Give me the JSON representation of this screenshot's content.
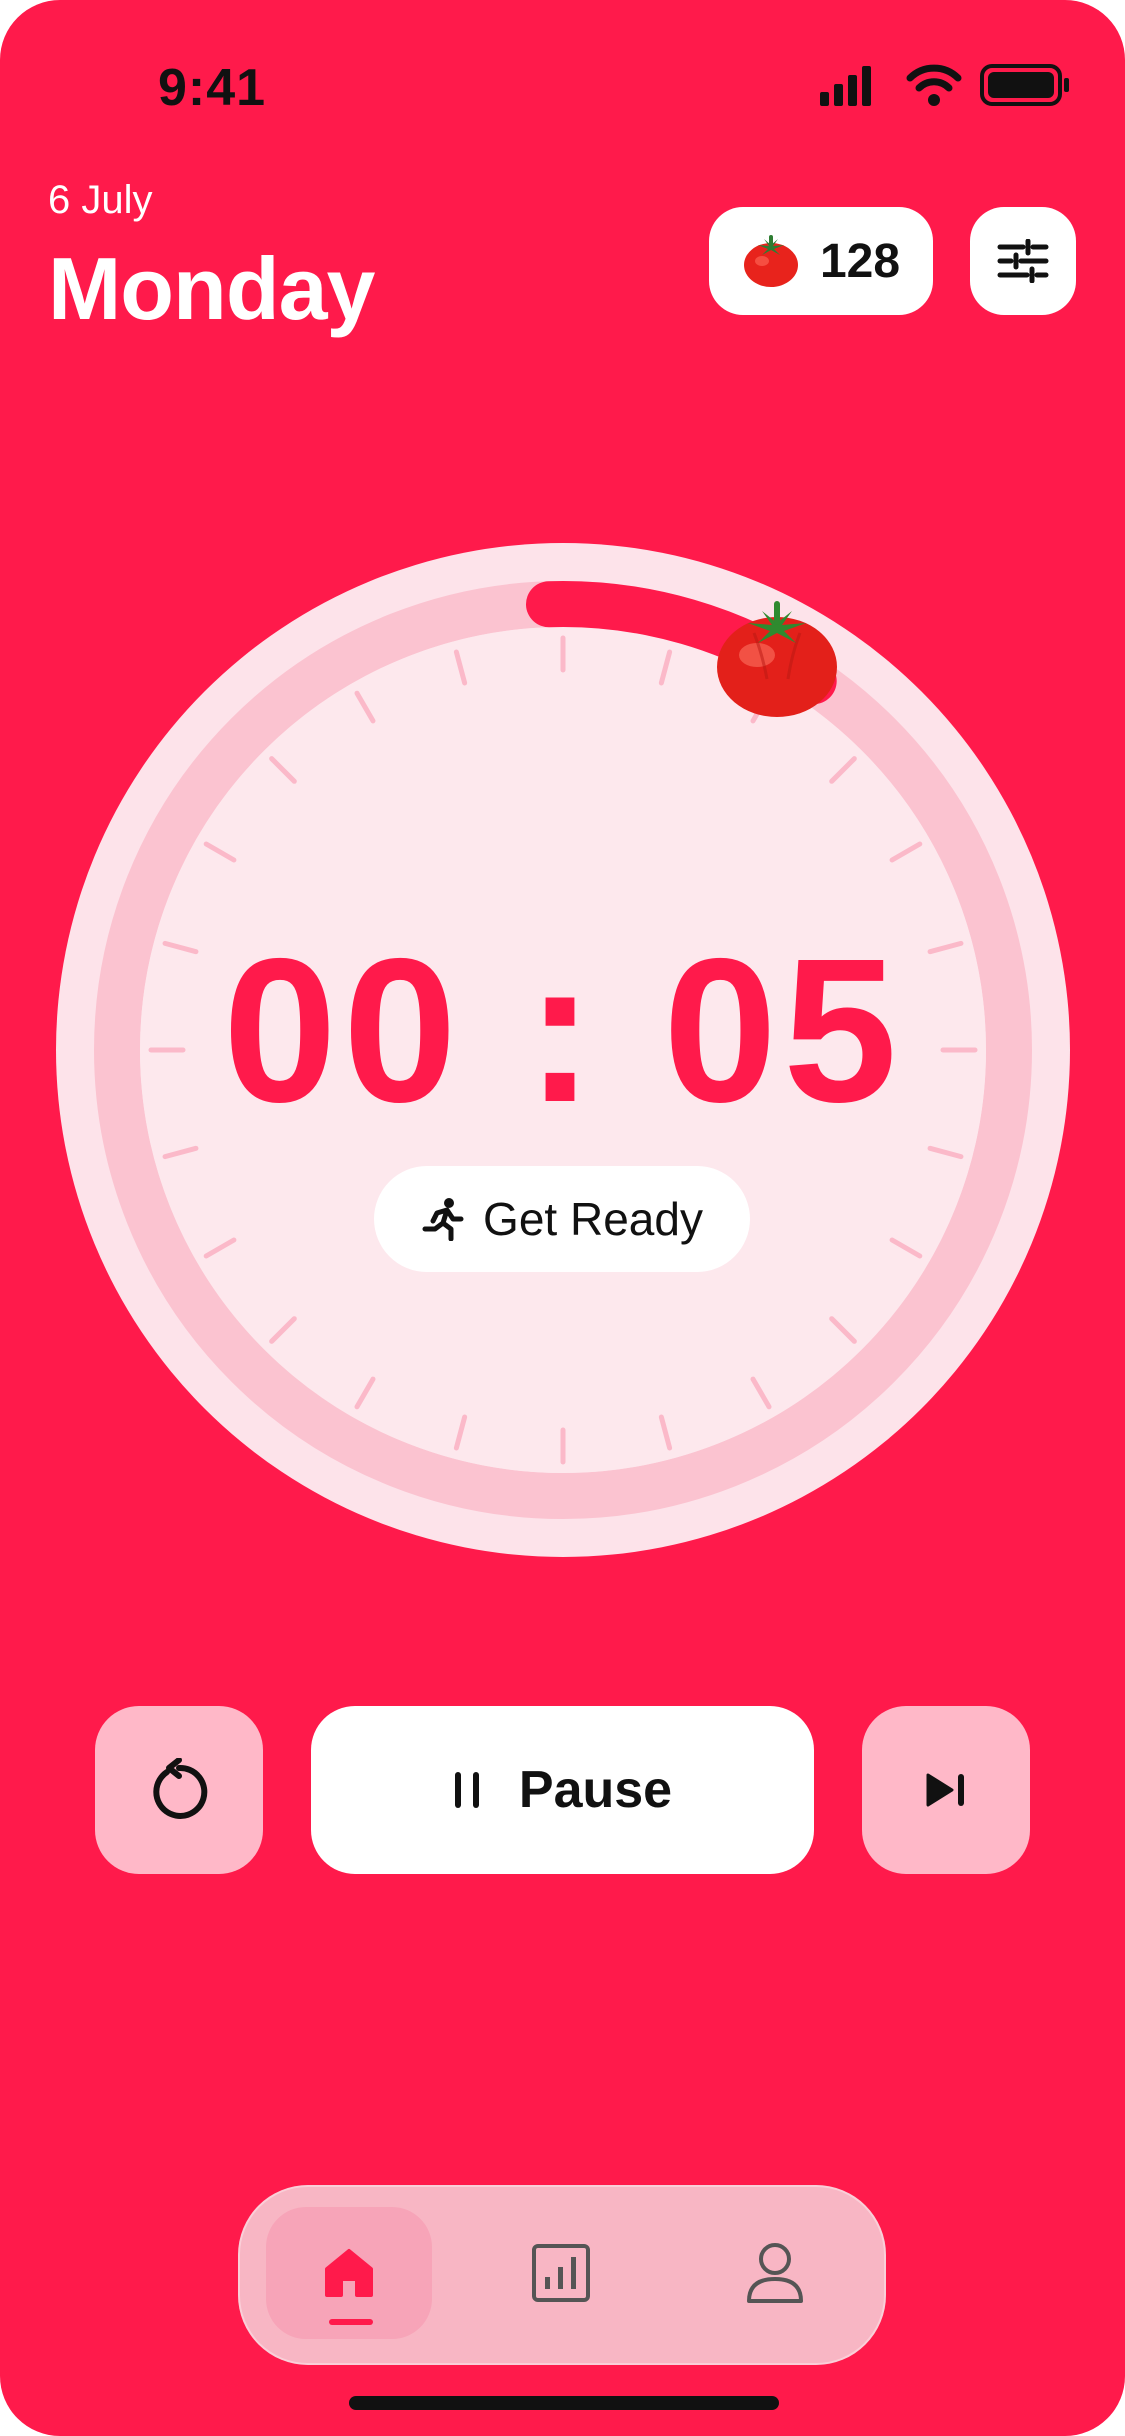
{
  "status_bar": {
    "time": "9:41",
    "icons": [
      "signal-icon",
      "wifi-icon",
      "battery-icon"
    ]
  },
  "header": {
    "date": "6 July",
    "day": "Monday",
    "tomato_count": "128",
    "settings_icon": "sliders-icon"
  },
  "timer": {
    "display": "00 : 05",
    "phase_label": "Get Ready",
    "phase_icon": "running-person-icon",
    "progress_fraction": 0.1
  },
  "controls": {
    "reset_icon": "reset-icon",
    "pause_label": "Pause",
    "pause_icon": "pause-icon",
    "skip_icon": "skip-next-icon"
  },
  "nav": {
    "items": [
      {
        "icon": "home-icon",
        "active": true
      },
      {
        "icon": "stats-icon",
        "active": false
      },
      {
        "icon": "profile-icon",
        "active": false
      }
    ]
  },
  "colors": {
    "background": "#ff1a4b",
    "accent": "#ff1a4b",
    "track": "#fbc3d0",
    "dial_face": "#fde8ed",
    "button_soft": "#ffb8c8"
  }
}
